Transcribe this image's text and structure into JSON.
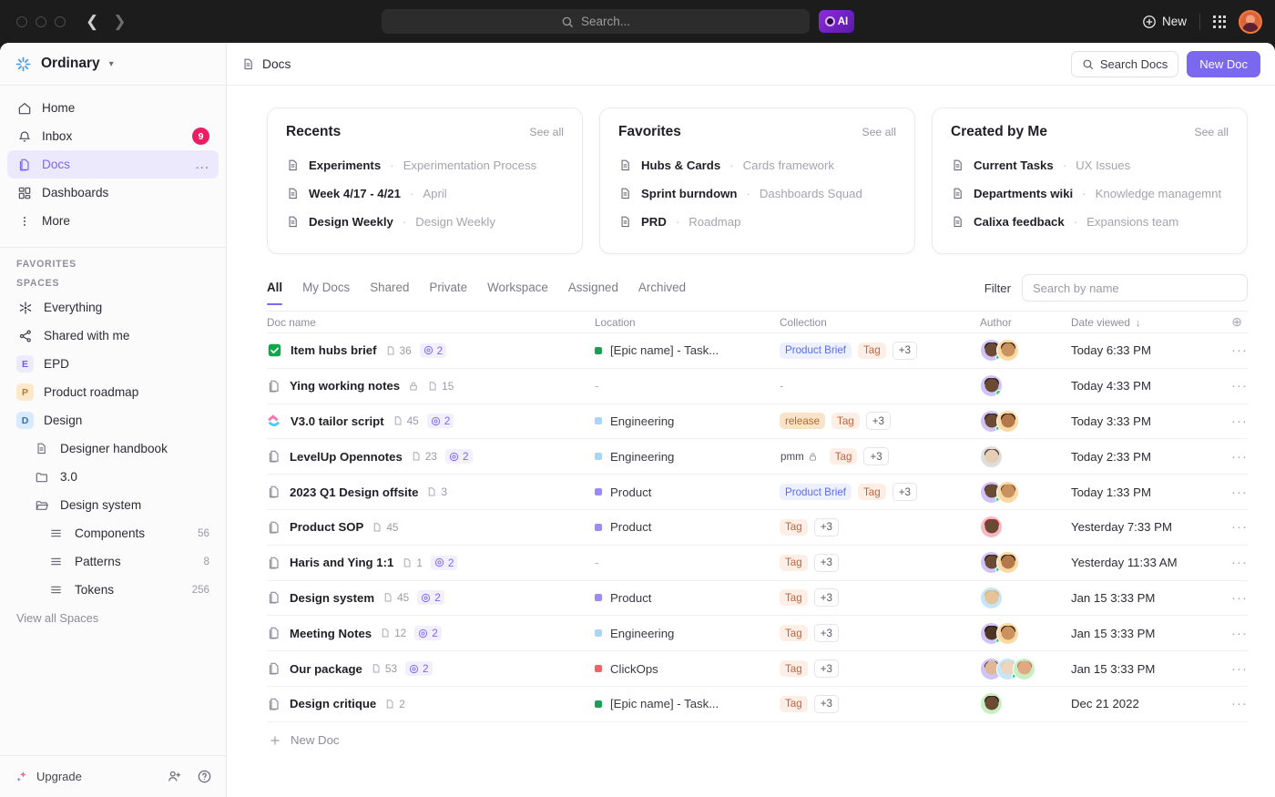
{
  "titlebar": {
    "search_placeholder": "Search...",
    "ai_label": "AI",
    "new_label": "New"
  },
  "sidebar": {
    "workspace": "Ordinary",
    "nav": [
      {
        "label": "Home",
        "icon": "home-icon"
      },
      {
        "label": "Inbox",
        "icon": "bell-icon",
        "badge": "9"
      },
      {
        "label": "Docs",
        "icon": "docs-icon",
        "active": true,
        "trailing": "..."
      },
      {
        "label": "Dashboards",
        "icon": "dashboards-icon"
      },
      {
        "label": "More",
        "icon": "more-vertical-icon"
      }
    ],
    "favorites_label": "FAVORITES",
    "spaces_label": "SPACES",
    "spaces": [
      {
        "label": "Everything",
        "icon": "everything-icon",
        "kind": "icon"
      },
      {
        "label": "Shared with me",
        "icon": "share-icon",
        "kind": "icon"
      },
      {
        "label": "EPD",
        "initial": "E",
        "bg": "#eceafd",
        "fg": "#6c5ce7",
        "kind": "square"
      },
      {
        "label": "Product roadmap",
        "initial": "P",
        "bg": "#fde8cc",
        "fg": "#c2772a",
        "kind": "square"
      },
      {
        "label": "Design",
        "initial": "D",
        "bg": "#d9eafd",
        "fg": "#2f6fc0",
        "kind": "square"
      },
      {
        "label": "Designer handbook",
        "icon": "doc-icon",
        "kind": "child"
      },
      {
        "label": "3.0",
        "icon": "folder-icon",
        "kind": "child"
      },
      {
        "label": "Design system",
        "icon": "folder-open-icon",
        "kind": "child"
      },
      {
        "label": "Components",
        "icon": "list-icon",
        "kind": "child2",
        "count": "56"
      },
      {
        "label": "Patterns",
        "icon": "list-icon",
        "kind": "child2",
        "count": "8"
      },
      {
        "label": "Tokens",
        "icon": "list-icon",
        "kind": "child2",
        "count": "256"
      }
    ],
    "view_all": "View all Spaces",
    "upgrade": "Upgrade"
  },
  "header": {
    "breadcrumb": "Docs",
    "search_docs": "Search Docs",
    "new_doc": "New Doc"
  },
  "cards": [
    {
      "title": "Recents",
      "see_all": "See all",
      "items": [
        {
          "name": "Experiments",
          "sub": "Experimentation Process"
        },
        {
          "name": "Week 4/17 - 4/21",
          "sub": "April"
        },
        {
          "name": "Design Weekly",
          "sub": "Design Weekly"
        }
      ]
    },
    {
      "title": "Favorites",
      "see_all": "See all",
      "items": [
        {
          "name": "Hubs & Cards",
          "sub": "Cards framework"
        },
        {
          "name": "Sprint burndown",
          "sub": "Dashboards Squad"
        },
        {
          "name": "PRD",
          "sub": "Roadmap"
        }
      ]
    },
    {
      "title": "Created by Me",
      "see_all": "See all",
      "items": [
        {
          "name": "Current Tasks",
          "sub": "UX Issues"
        },
        {
          "name": "Departments wiki",
          "sub": "Knowledge managemnt"
        },
        {
          "name": "Calixa feedback",
          "sub": "Expansions team"
        }
      ]
    }
  ],
  "tabs": [
    {
      "label": "All",
      "active": true
    },
    {
      "label": "My Docs"
    },
    {
      "label": "Shared"
    },
    {
      "label": "Private"
    },
    {
      "label": "Workspace"
    },
    {
      "label": "Assigned"
    },
    {
      "label": "Archived"
    }
  ],
  "filter": {
    "label": "Filter",
    "placeholder": "Search by name"
  },
  "table": {
    "columns": [
      "Doc name",
      "Location",
      "Collection",
      "Author",
      "Date viewed"
    ],
    "sort_indicator": "↓",
    "new_doc_row": "New Doc",
    "rows": [
      {
        "icon": "checkbox-checked-icon",
        "name": "Item hubs brief",
        "pages": "36",
        "mentions": "2",
        "locked": false,
        "location": "[Epic name] - Task...",
        "loc_color": "#1f9f52",
        "tags": [
          {
            "text": "Product Brief",
            "style": "blue"
          },
          {
            "text": "Tag",
            "style": "tagdef"
          },
          {
            "text": "+3",
            "style": "plain"
          }
        ],
        "avatars": [
          {
            "bg": "#cfc3f7",
            "skin": "#6b4a33",
            "hair": "#241712",
            "online": true
          },
          {
            "bg": "#fbd9a5",
            "skin": "#c9925f",
            "hair": "#2a1a10",
            "online": false
          }
        ],
        "date": "Today 6:33 PM"
      },
      {
        "icon": "doc-icon",
        "name": "Ying working notes",
        "pages": "15",
        "mentions": "",
        "locked": true,
        "location": "-",
        "loc_color": "",
        "tags": [
          {
            "text": "-",
            "style": "none"
          }
        ],
        "avatars": [
          {
            "bg": "#cfc3f7",
            "skin": "#6b4a33",
            "hair": "#241712",
            "online": true
          }
        ],
        "date": "Today 4:33 PM"
      },
      {
        "icon": "clickup-logo-icon",
        "name": "V3.0 tailor script",
        "pages": "45",
        "mentions": "2",
        "locked": false,
        "location": "Engineering",
        "loc_color": "#a9d5f7",
        "tags": [
          {
            "text": "release",
            "style": "orange"
          },
          {
            "text": "Tag",
            "style": "tagdef"
          },
          {
            "text": "+3",
            "style": "plain"
          }
        ],
        "avatars": [
          {
            "bg": "#cfc3f7",
            "skin": "#6b4a33",
            "hair": "#241712",
            "online": true
          },
          {
            "bg": "#fbd9a5",
            "skin": "#b3794a",
            "hair": "#181008",
            "online": false
          }
        ],
        "date": "Today 3:33 PM"
      },
      {
        "icon": "doc-icon",
        "name": "LevelUp Opennotes",
        "pages": "23",
        "mentions": "2",
        "locked": false,
        "location": "Engineering",
        "loc_color": "#a9d5f7",
        "tags": [
          {
            "text": "pmm",
            "style": "plainpmm"
          },
          {
            "text": "Tag",
            "style": "tagdef"
          },
          {
            "text": "+3",
            "style": "plain"
          }
        ],
        "avatars": [
          {
            "bg": "#dedede",
            "skin": "#e6cdb5",
            "hair": "#4a3426",
            "online": false
          }
        ],
        "date": "Today 2:33 PM"
      },
      {
        "icon": "doc-icon",
        "name": "2023 Q1 Design offsite",
        "pages": "3",
        "mentions": "",
        "locked": false,
        "location": "Product",
        "loc_color": "#9b8bf4",
        "tags": [
          {
            "text": "Product Brief",
            "style": "blue"
          },
          {
            "text": "Tag",
            "style": "tagdef"
          },
          {
            "text": "+3",
            "style": "plain"
          }
        ],
        "avatars": [
          {
            "bg": "#cfc3f7",
            "skin": "#6b4a33",
            "hair": "#241712",
            "online": true
          },
          {
            "bg": "#fbd9a5",
            "skin": "#c9925f",
            "hair": "#2a1a10",
            "online": false
          }
        ],
        "date": "Today 1:33 PM"
      },
      {
        "icon": "doc-icon",
        "name": "Product SOP",
        "pages": "45",
        "mentions": "",
        "locked": false,
        "location": "Product",
        "loc_color": "#9b8bf4",
        "tags": [
          {
            "text": "Tag",
            "style": "tagdef"
          },
          {
            "text": "+3",
            "style": "plain"
          }
        ],
        "avatars": [
          {
            "bg": "#f6b9c4",
            "skin": "#6b4a33",
            "hair": "#b5202a",
            "online": false
          }
        ],
        "date": "Yesterday 7:33 PM"
      },
      {
        "icon": "doc-icon",
        "name": "Haris and Ying 1:1",
        "pages": "1",
        "mentions": "2",
        "locked": false,
        "location": "-",
        "loc_color": "",
        "tags": [
          {
            "text": "Tag",
            "style": "tagdef"
          },
          {
            "text": "+3",
            "style": "plain"
          }
        ],
        "avatars": [
          {
            "bg": "#cfc3f7",
            "skin": "#6b4a33",
            "hair": "#241712",
            "online": true
          },
          {
            "bg": "#fbd9a5",
            "skin": "#b3794a",
            "hair": "#181008",
            "online": false
          }
        ],
        "date": "Yesterday 11:33 AM"
      },
      {
        "icon": "doc-icon",
        "name": "Design system",
        "pages": "45",
        "mentions": "2",
        "locked": false,
        "location": "Product",
        "loc_color": "#9b8bf4",
        "tags": [
          {
            "text": "Tag",
            "style": "tagdef"
          },
          {
            "text": "+3",
            "style": "plain"
          }
        ],
        "avatars": [
          {
            "bg": "#c5e6f8",
            "skin": "#e6c49b",
            "hair": "#d9b277",
            "online": false
          }
        ],
        "date": "Jan 15 3:33 PM"
      },
      {
        "icon": "doc-icon",
        "name": "Meeting Notes",
        "pages": "12",
        "mentions": "2",
        "locked": false,
        "location": "Engineering",
        "loc_color": "#a9d5f7",
        "tags": [
          {
            "text": "Tag",
            "style": "tagdef"
          },
          {
            "text": "+3",
            "style": "plain"
          }
        ],
        "avatars": [
          {
            "bg": "#cfc3f7",
            "skin": "#4e3422",
            "hair": "#1a1008",
            "online": true
          },
          {
            "bg": "#fbd9a5",
            "skin": "#c9925f",
            "hair": "#2a1a10",
            "online": false
          }
        ],
        "date": "Jan 15 3:33 PM"
      },
      {
        "icon": "doc-icon",
        "name": "Our package",
        "pages": "53",
        "mentions": "2",
        "locked": false,
        "location": "ClickOps",
        "loc_color": "#ef6464",
        "tags": [
          {
            "text": "Tag",
            "style": "tagdef"
          },
          {
            "text": "+3",
            "style": "plain"
          }
        ],
        "avatars": [
          {
            "bg": "#cfc3f7",
            "skin": "#e0b894",
            "hair": "#1c1410",
            "online": false
          },
          {
            "bg": "#c5e6f8",
            "skin": "#efd5bb",
            "hair": "#e0c089",
            "online": true
          },
          {
            "bg": "#c7efc4",
            "skin": "#e2a882",
            "hair": "#c0502a",
            "online": false
          }
        ],
        "date": "Jan 15 3:33 PM"
      },
      {
        "icon": "doc-icon",
        "name": "Design critique",
        "pages": "2",
        "mentions": "",
        "locked": false,
        "location": "[Epic name] - Task...",
        "loc_color": "#1f9f52",
        "tags": [
          {
            "text": "Tag",
            "style": "tagdef"
          },
          {
            "text": "+3",
            "style": "plain"
          }
        ],
        "avatars": [
          {
            "bg": "#c7efc4",
            "skin": "#6b4a33",
            "hair": "#241712",
            "online": false
          }
        ],
        "date": "Dec 21 2022"
      }
    ]
  },
  "colors": {
    "accent": "#7b68ee",
    "badge": "#e91e63",
    "active_bg": "#ece9fd"
  }
}
